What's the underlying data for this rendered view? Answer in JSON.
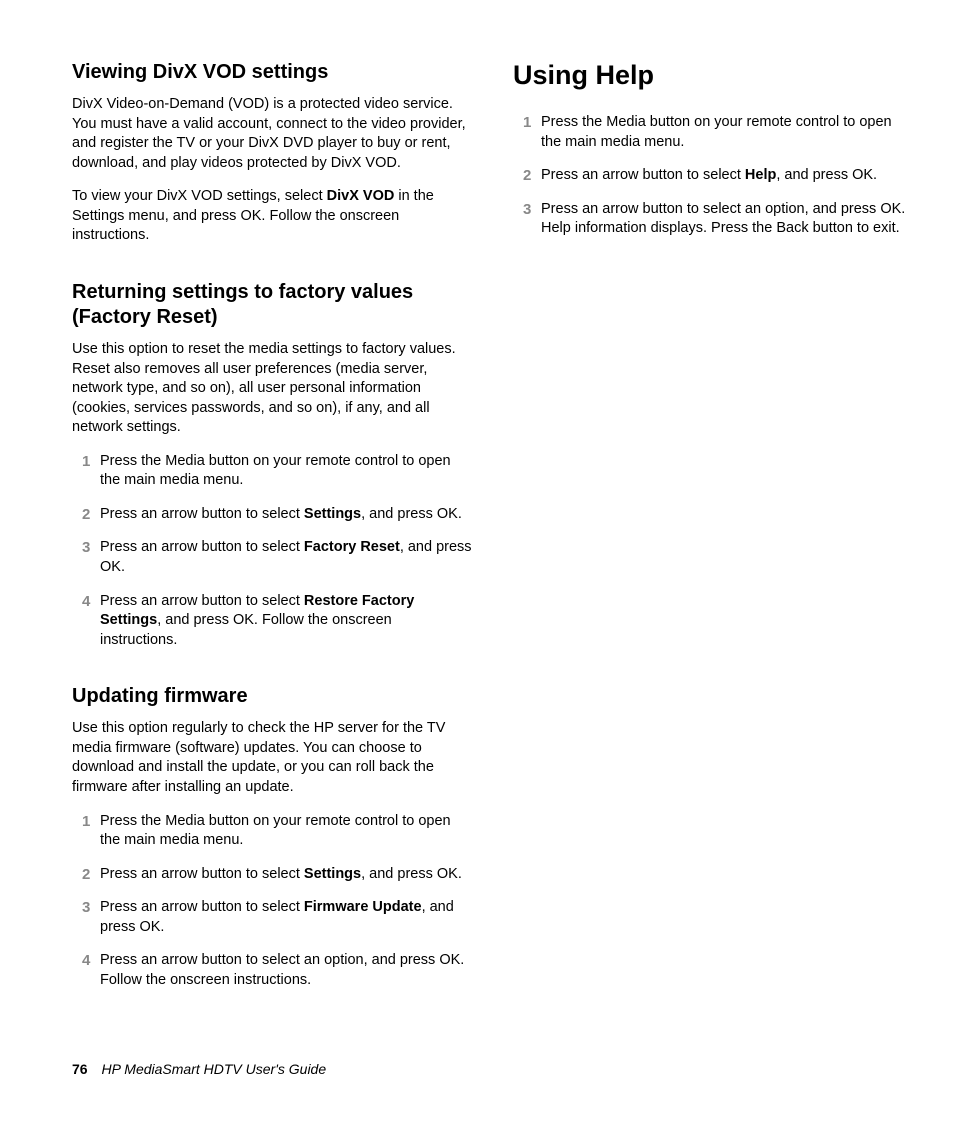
{
  "left": {
    "sec1": {
      "heading": "Viewing DivX VOD settings",
      "p1": "DivX Video-on-Demand (VOD) is a protected video service. You must have a valid account, connect to the video provider, and register the TV or your DivX DVD player to buy or rent, download, and play videos protected by DivX VOD.",
      "p2_a": "To view your DivX VOD settings, select ",
      "p2_bold": "DivX VOD",
      "p2_b": " in the Settings menu, and press OK. Follow the onscreen instructions."
    },
    "sec2": {
      "heading": "Returning settings to factory values (Factory Reset)",
      "p1": "Use this option to reset the media settings to factory values. Reset also removes all user preferences (media server, network type, and so on), all user personal information (cookies, services passwords, and so on), if any, and all network settings.",
      "steps": {
        "n1": "1",
        "s1": "Press the Media button on your remote control to open the main media menu.",
        "n2": "2",
        "s2_a": "Press an arrow button to select ",
        "s2_bold": "Settings",
        "s2_b": ", and press OK.",
        "n3": "3",
        "s3_a": "Press an arrow button to select ",
        "s3_bold": "Factory Reset",
        "s3_b": ", and press OK.",
        "n4": "4",
        "s4_a": "Press an arrow button to select ",
        "s4_bold": "Restore Factory Settings",
        "s4_b": ", and press OK. Follow the onscreen instructions."
      }
    },
    "sec3": {
      "heading": "Updating firmware",
      "p1": "Use this option regularly to check the HP server for the TV media firmware (software) updates. You can choose to download and install the update, or you can roll back the firmware after installing an update.",
      "steps": {
        "n1": "1",
        "s1": "Press the Media button on your remote control to open the main media menu.",
        "n2": "2",
        "s2_a": "Press an arrow button to select ",
        "s2_bold": "Settings",
        "s2_b": ", and press OK.",
        "n3": "3",
        "s3_a": "Press an arrow button to select ",
        "s3_bold": "Firmware Update",
        "s3_b": ", and press OK.",
        "n4": "4",
        "s4": "Press an arrow button to select an option, and press OK. Follow the onscreen instructions."
      }
    }
  },
  "right": {
    "heading": "Using Help",
    "steps": {
      "n1": "1",
      "s1": "Press the Media button on your remote control to open the main media menu.",
      "n2": "2",
      "s2_a": "Press an arrow button to select ",
      "s2_bold": "Help",
      "s2_b": ", and press OK.",
      "n3": "3",
      "s3": "Press an arrow button to select an option, and press OK. Help information displays. Press the Back button to exit."
    }
  },
  "footer": {
    "page": "76",
    "title": "HP MediaSmart HDTV User's Guide"
  }
}
